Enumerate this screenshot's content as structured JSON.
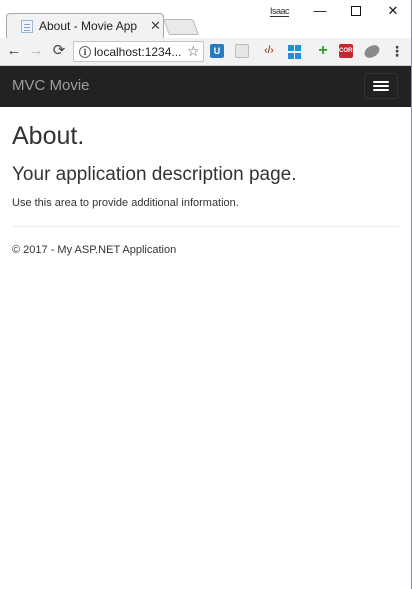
{
  "browser": {
    "tab": {
      "title": "About - Movie App",
      "close_symbol": "✕",
      "favicon": "page-icon"
    },
    "new_tab": "new-tab-button",
    "profile_label": "Isaac",
    "window_controls": {
      "minimize": "—",
      "maximize": "maximize-icon",
      "close": "✕"
    },
    "toolbar": {
      "back": "←",
      "forward": "→",
      "reload": "⟳",
      "url": "localhost:1234...",
      "bookmark": "☆",
      "menu": "⋮",
      "extensions": [
        {
          "name": "bitwarden-icon",
          "glyph": "U"
        },
        {
          "name": "extension-icon-gray",
          "glyph": ""
        },
        {
          "name": "code-icon",
          "glyph": "‹/›"
        },
        {
          "name": "windows-icon",
          "glyph": ""
        },
        {
          "name": "plus-icon",
          "glyph": "+"
        },
        {
          "name": "cors-icon",
          "glyph": "CORS"
        },
        {
          "name": "football-icon",
          "glyph": ""
        }
      ]
    },
    "colors": {
      "navbar_bg": "#222222",
      "brand_text": "#9d9d9d",
      "window_border": "#5aa3a8"
    }
  },
  "app": {
    "brand": "MVC Movie",
    "menu_toggle": "hamburger-icon"
  },
  "page": {
    "title": "About.",
    "subtitle": "Your application description page.",
    "text": "Use this area to provide additional information.",
    "footer": "© 2017 - My ASP.NET Application"
  }
}
